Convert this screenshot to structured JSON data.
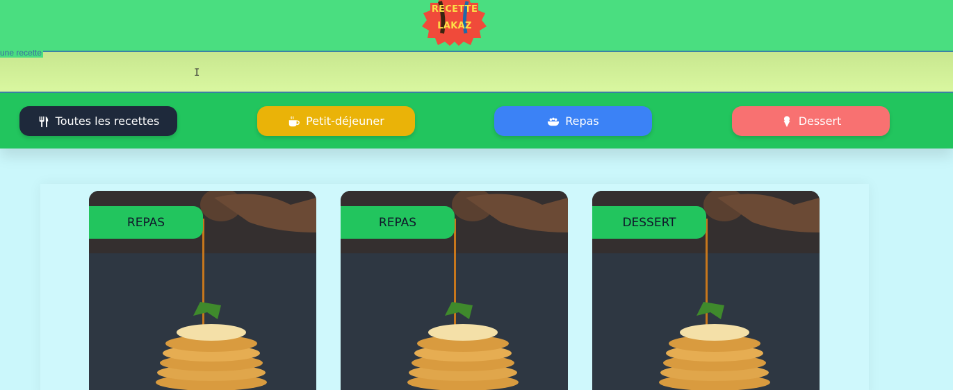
{
  "header": {
    "logo_line1": "RECETTE",
    "logo_line2": "LAKAZ"
  },
  "search": {
    "label": "une recette",
    "value": ""
  },
  "categories": [
    {
      "label": "Toutes les recettes",
      "icon": "utensils-icon",
      "color": "#1e293b"
    },
    {
      "label": "Petit-déjeuner",
      "icon": "coffee-mug-icon",
      "color": "#eab308"
    },
    {
      "label": "Repas",
      "icon": "bowl-icon",
      "color": "#3b82f6"
    },
    {
      "label": "Dessert",
      "icon": "ice-cream-icon",
      "color": "#f87171"
    }
  ],
  "recipes": [
    {
      "category": "REPAS",
      "image": "pancakes-syrup-photo"
    },
    {
      "category": "REPAS",
      "image": "pancakes-syrup-photo"
    },
    {
      "category": "DESSERT",
      "image": "pancakes-syrup-photo"
    }
  ],
  "colors": {
    "header_bg": "#4ade80",
    "category_bar_bg": "#22c55e",
    "page_bg": "#cbf7fb",
    "logo_text": "#fde047",
    "logo_badge": "#f04a3a"
  }
}
